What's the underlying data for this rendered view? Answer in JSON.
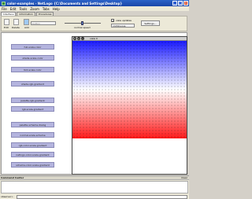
{
  "window": {
    "title": "color-examples - NetLogo {C:\\Documents and Settings\\Desktop}"
  },
  "menu": [
    "File",
    "Edit",
    "Tools",
    "Zoom",
    "Tabs",
    "Help"
  ],
  "tabs": [
    "Interface",
    "Information",
    "Procedures"
  ],
  "toolbar": {
    "edit_label": "Edit",
    "delete_label": "Delete",
    "add_label": "Add",
    "add_combo": "button",
    "speed_label": "normal speed",
    "view_updates_label": "view updates",
    "update_mode": "continuous",
    "settings_label": "Settings..."
  },
  "buttons": [
    "full-scale-color",
    "shade-scale-color",
    "tint-scale-color",
    "shade-rgb-gradient",
    "palette-rgb-gradient",
    "rgb-scale-gradient",
    "palette-scheme-dialog",
    "normal-scale-scheme",
    "rgb-color-scale-gradient",
    "netlogo-color-scale-gradient",
    "scheme-color-scale-gradient"
  ],
  "view": {
    "title": "view 0"
  },
  "command_center": {
    "title": "Command Center",
    "clear_label": "Clear",
    "agent": "observer>"
  },
  "colors": {
    "red": "#ff1a1a",
    "white": "#ffffff",
    "blue": "#1a1aff"
  }
}
